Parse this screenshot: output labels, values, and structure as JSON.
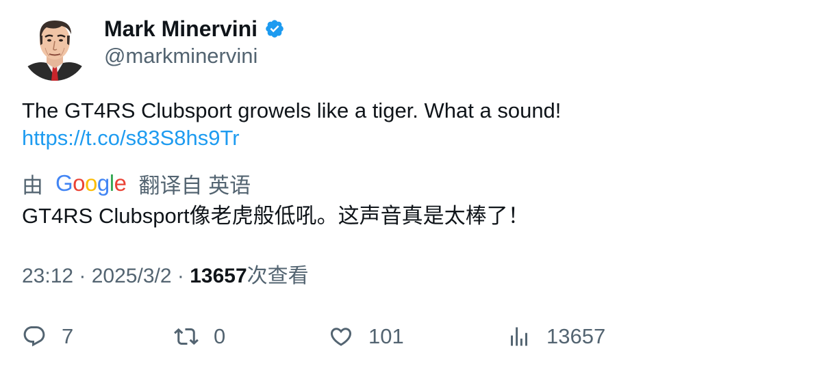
{
  "author": {
    "name": "Mark Minervini",
    "handle": "@markminervini",
    "verified": true,
    "verified_color": "#1d9bf0"
  },
  "tweet": {
    "text": "The GT4RS Clubsport growels like a tiger. What a sound!",
    "link": "https://t.co/s83S8hs9Tr",
    "link_color": "#1d9bf0"
  },
  "translation": {
    "prefix": "由",
    "provider": "Google",
    "suffix": "翻译自 英语",
    "text": "GT4RS Clubsport像老虎般低吼。这声音真是太棒了！"
  },
  "meta": {
    "time": "23:12",
    "separator": "·",
    "date": "2025/3/2",
    "views_count": "13657",
    "views_label": "次查看"
  },
  "actions": {
    "replies": "7",
    "retweets": "0",
    "likes": "101",
    "views": "13657"
  }
}
